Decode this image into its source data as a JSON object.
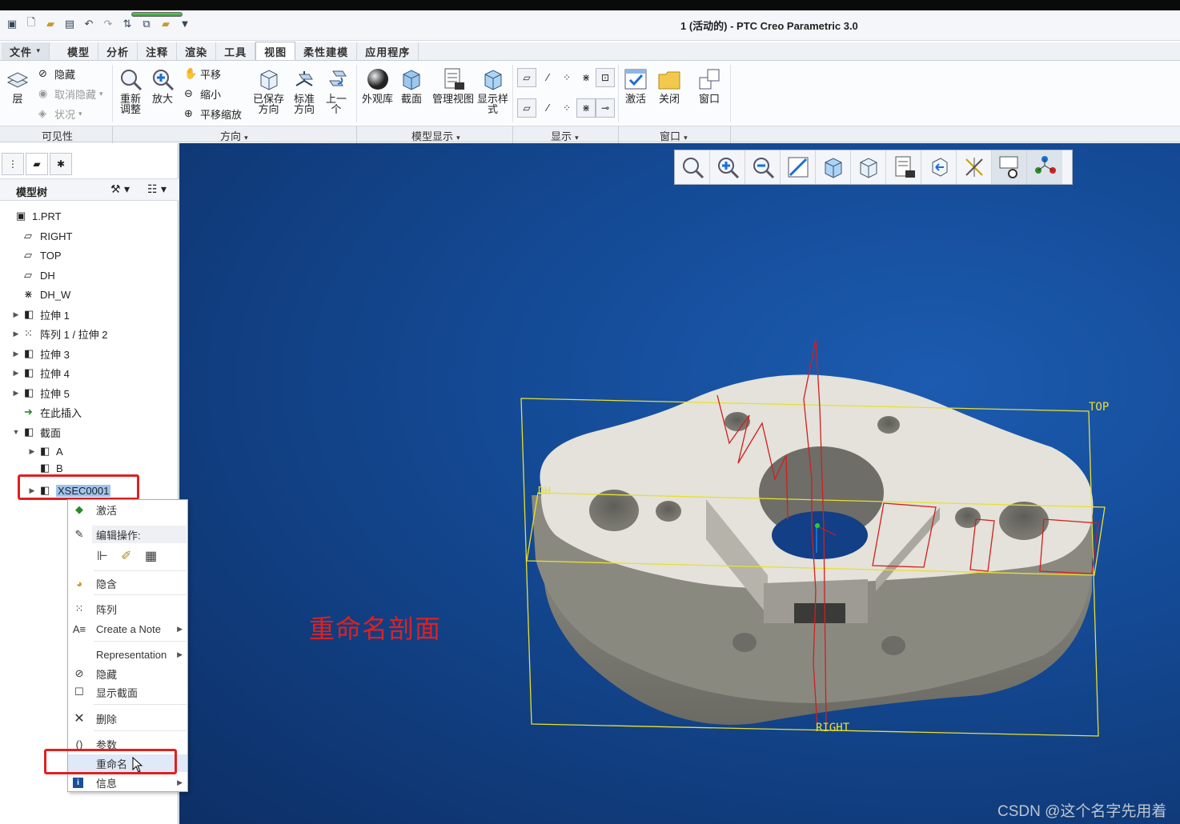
{
  "window": {
    "title": "1 (活动的) - PTC Creo Parametric 3.0"
  },
  "tabs": [
    {
      "label": "文件",
      "dropdown": "▾"
    },
    {
      "label": "模型"
    },
    {
      "label": "分析"
    },
    {
      "label": "注释"
    },
    {
      "label": "渲染"
    },
    {
      "label": "工具"
    },
    {
      "label": "视图"
    },
    {
      "label": "柔性建模"
    },
    {
      "label": "应用程序"
    }
  ],
  "ribbon": {
    "visibility": {
      "layer": "层",
      "hide": "隐藏",
      "unhide": "取消隐藏",
      "status": "状况",
      "group": "可见性"
    },
    "orientation": {
      "refit": [
        "重新",
        "调整"
      ],
      "zoom_in": "放大",
      "pan": "平移",
      "zoom_out": "缩小",
      "pan_zoom": "平移缩放",
      "saved": [
        "已保存",
        "方向"
      ],
      "standard": [
        "标准",
        "方向"
      ],
      "previous": [
        "上一",
        "个"
      ],
      "group": "方向"
    },
    "model_display": {
      "appearance": "外观库",
      "section": "截面",
      "manage_views": "管理视图",
      "display_style": [
        "显示样",
        "式"
      ],
      "group": "模型显示"
    },
    "show": {
      "group": "显示"
    },
    "window": {
      "activate": "激活",
      "close": "关闭",
      "windows": "窗口",
      "group": "窗口"
    }
  },
  "model_tree": {
    "header": "模型树",
    "nodes": [
      {
        "label": "1.PRT"
      },
      {
        "label": "RIGHT"
      },
      {
        "label": "TOP"
      },
      {
        "label": "DH"
      },
      {
        "label": "DH_W"
      },
      {
        "label": "拉伸 1"
      },
      {
        "label": "阵列 1 / 拉伸 2"
      },
      {
        "label": "拉伸 3"
      },
      {
        "label": "拉伸 4"
      },
      {
        "label": "拉伸 5"
      },
      {
        "label": "在此插入"
      },
      {
        "label": "截面"
      },
      {
        "label": "A"
      },
      {
        "label": "B"
      },
      {
        "label": "XSEC0001"
      }
    ]
  },
  "context_menu": {
    "activate": "激活",
    "edit_ops": "编辑操作:",
    "hide_compose": "隐含",
    "pattern": "阵列",
    "create_note": "Create a Note",
    "representation": "Representation",
    "hide": "隐藏",
    "show_section": "显示截面",
    "delete": "删除",
    "parameters": "参数",
    "rename": "重命名",
    "info": "信息"
  },
  "viewport": {
    "annotation": "重命名剖面",
    "datum_labels": {
      "top": "TOP",
      "right": "RIGHT",
      "dh": "DH"
    },
    "watermark": "CSDN @这个名字先用着"
  },
  "colors": {
    "annotation": "#e02020",
    "viewport_bg": "#144a95",
    "selection": "#9fc3ec"
  }
}
